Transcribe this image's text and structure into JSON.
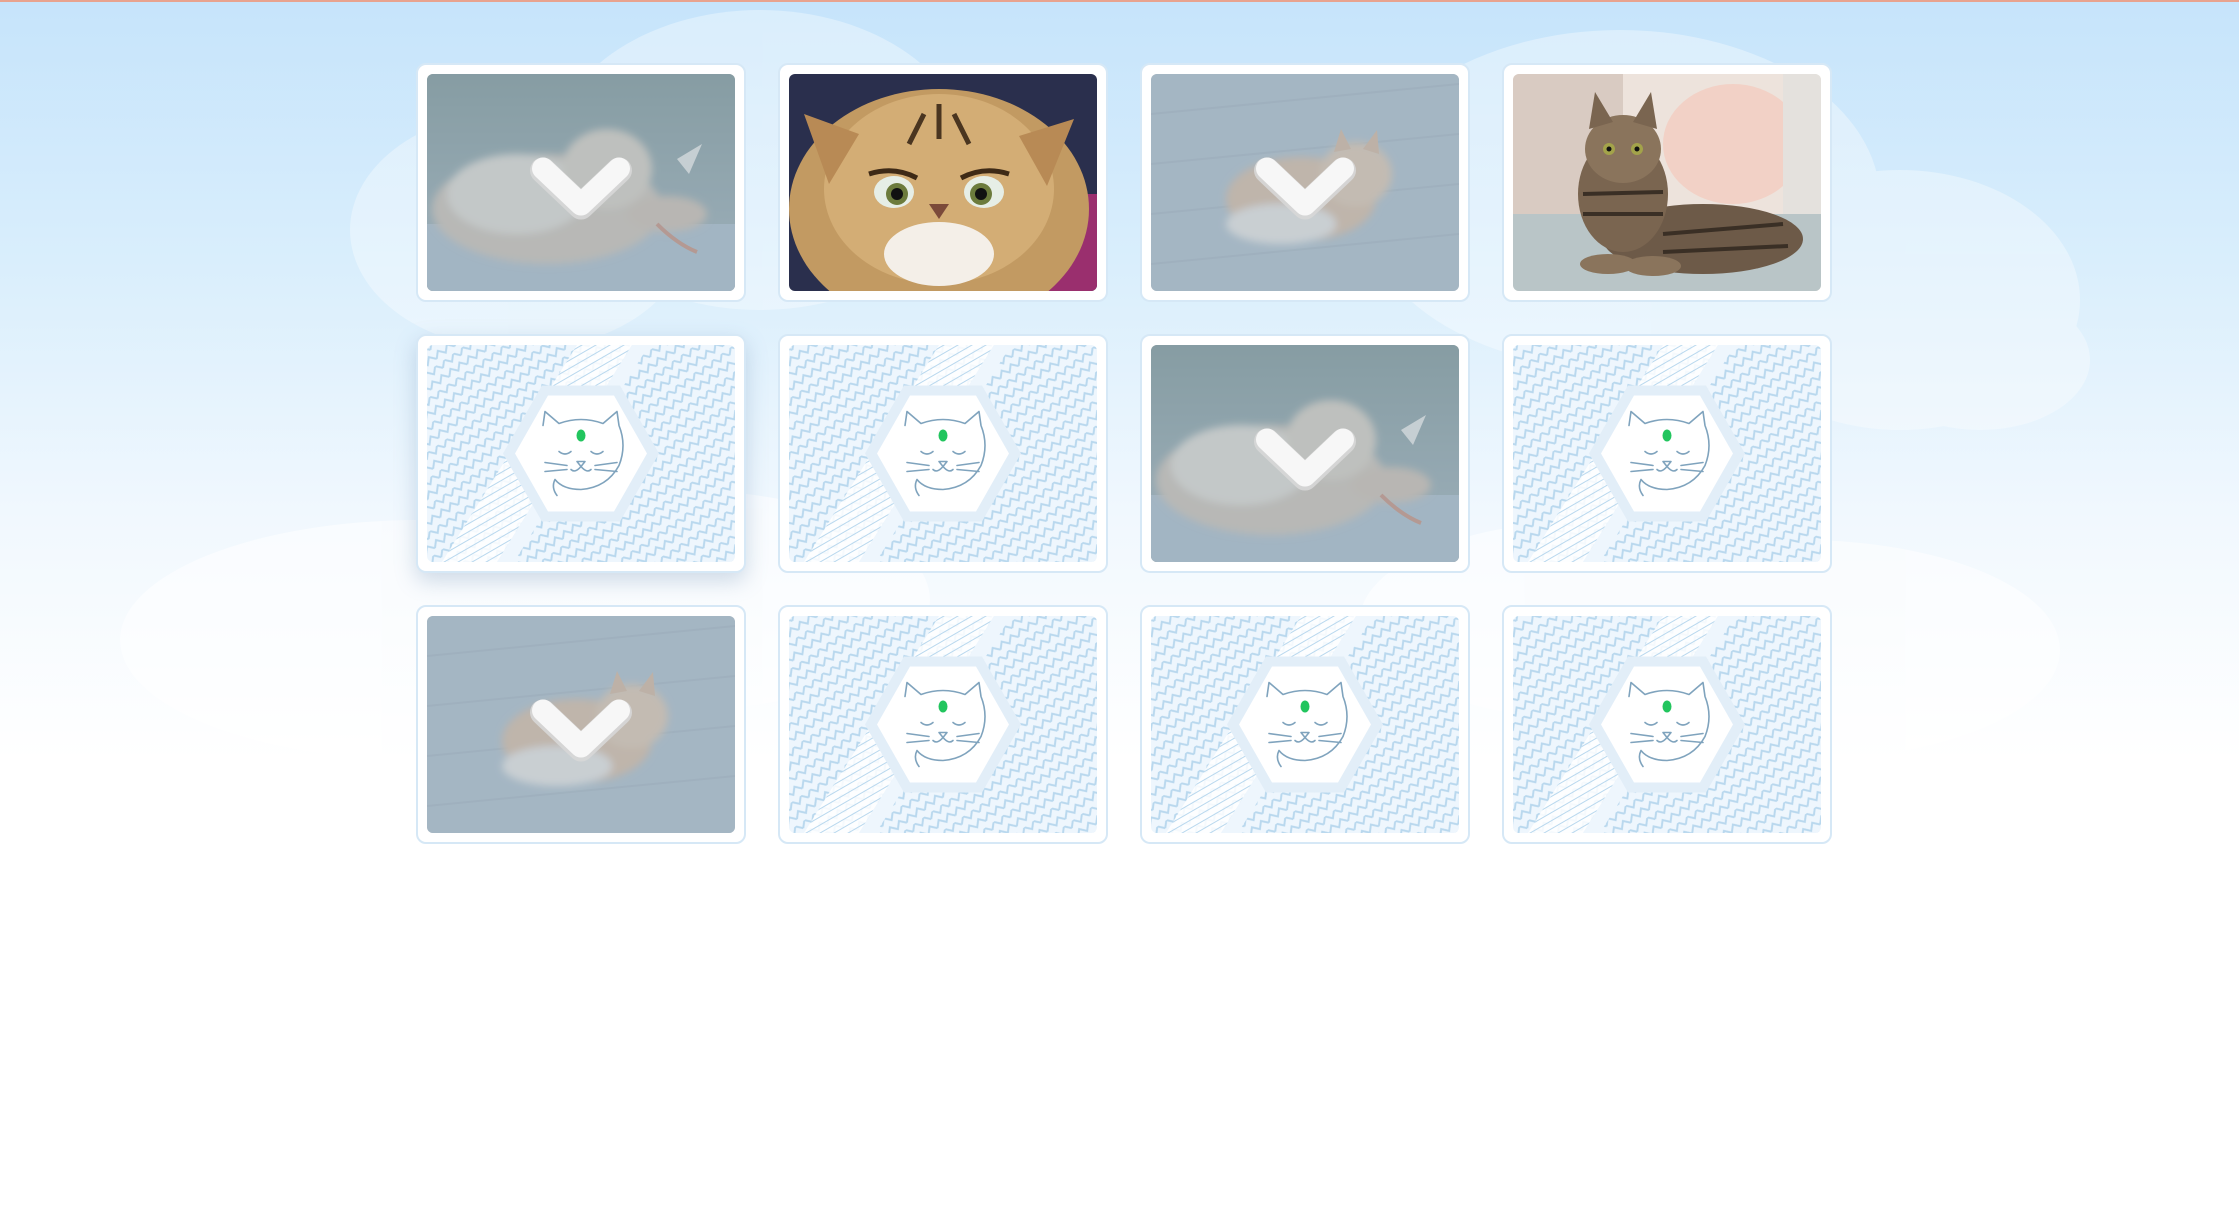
{
  "game": {
    "type": "memory-match",
    "columns": 4,
    "rows": 3,
    "cards": [
      {
        "position": 1,
        "state": "matched",
        "image": "fluffy-cat-curled-photo",
        "overlay_icon": "check-icon"
      },
      {
        "position": 2,
        "state": "revealed",
        "image": "persian-cat-face-photo"
      },
      {
        "position": 3,
        "state": "matched",
        "image": "orange-cat-lying-photo",
        "overlay_icon": "check-icon"
      },
      {
        "position": 4,
        "state": "revealed",
        "image": "tabby-cat-on-sofa-photo"
      },
      {
        "position": 5,
        "state": "face-down",
        "back_icon": "cat-face-icon",
        "hover": true
      },
      {
        "position": 6,
        "state": "face-down",
        "back_icon": "cat-face-icon"
      },
      {
        "position": 7,
        "state": "matched",
        "image": "fluffy-cat-curled-photo",
        "overlay_icon": "check-icon"
      },
      {
        "position": 8,
        "state": "face-down",
        "back_icon": "cat-face-icon"
      },
      {
        "position": 9,
        "state": "matched",
        "image": "orange-cat-lying-photo",
        "overlay_icon": "check-icon"
      },
      {
        "position": 10,
        "state": "face-down",
        "back_icon": "cat-face-icon"
      },
      {
        "position": 11,
        "state": "face-down",
        "back_icon": "cat-face-icon"
      },
      {
        "position": 12,
        "state": "face-down",
        "back_icon": "cat-face-icon"
      }
    ]
  },
  "colors": {
    "sky_top": "#c6e4fb",
    "card_border": "#d6e8f6",
    "card_back_pattern": "#b9d8ee",
    "cat_line": "#7fa3bd",
    "cat_dot": "#22c55e",
    "matched_overlay": "#a9c4d8"
  }
}
